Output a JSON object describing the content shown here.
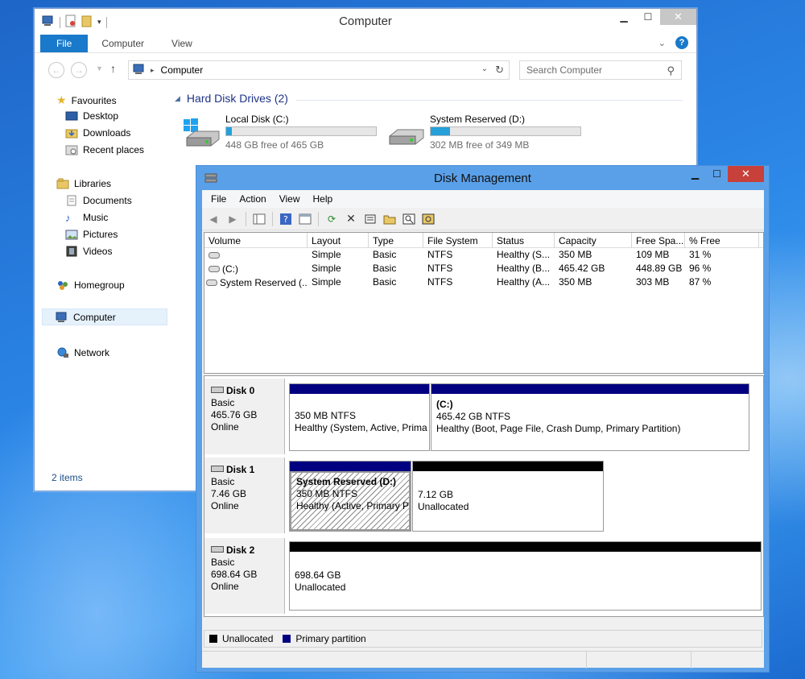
{
  "explorer": {
    "title": "Computer",
    "ribbon_tabs": [
      "File",
      "Computer",
      "View"
    ],
    "address": "Computer",
    "search_placeholder": "Search Computer",
    "nav": {
      "favourites": "Favourites",
      "desktop": "Desktop",
      "downloads": "Downloads",
      "recent": "Recent places",
      "libraries": "Libraries",
      "documents": "Documents",
      "music": "Music",
      "pictures": "Pictures",
      "videos": "Videos",
      "homegroup": "Homegroup",
      "computer": "Computer",
      "network": "Network"
    },
    "group_header": "Hard Disk Drives (2)",
    "drives": [
      {
        "name": "Local Disk (C:)",
        "free_text": "448 GB free of 465 GB",
        "used_fraction": 0.04
      },
      {
        "name": "System Reserved (D:)",
        "free_text": "302 MB free of 349 MB",
        "used_fraction": 0.13
      }
    ],
    "status": "2 items"
  },
  "dm": {
    "title": "Disk Management",
    "menu": [
      "File",
      "Action",
      "View",
      "Help"
    ],
    "columns": [
      "Volume",
      "Layout",
      "Type",
      "File System",
      "Status",
      "Capacity",
      "Free Spa...",
      "% Free"
    ],
    "rows": [
      [
        "",
        "Simple",
        "Basic",
        "NTFS",
        "Healthy (S...",
        "350 MB",
        "109 MB",
        "31 %"
      ],
      [
        "(C:)",
        "Simple",
        "Basic",
        "NTFS",
        "Healthy (B...",
        "465.42 GB",
        "448.89 GB",
        "96 %"
      ],
      [
        "System Reserved (...",
        "Simple",
        "Basic",
        "NTFS",
        "Healthy (A...",
        "350 MB",
        "303 MB",
        "87 %"
      ]
    ],
    "disks": [
      {
        "name": "Disk 0",
        "type": "Basic",
        "size": "465.76 GB",
        "state": "Online",
        "partitions": [
          {
            "name": "",
            "size": "350 MB NTFS",
            "status": "Healthy (System, Active, Prima"
          },
          {
            "name": "(C:)",
            "size": "465.42 GB NTFS",
            "status": "Healthy (Boot, Page File, Crash Dump, Primary Partition)"
          }
        ]
      },
      {
        "name": "Disk 1",
        "type": "Basic",
        "size": "7.46 GB",
        "state": "Online",
        "partitions": [
          {
            "name": "System Reserved  (D:)",
            "size": "350 MB NTFS",
            "status": "Healthy (Active, Primary P"
          },
          {
            "name": "",
            "size": "7.12 GB",
            "status": "Unallocated"
          }
        ]
      },
      {
        "name": "Disk 2",
        "type": "Basic",
        "size": "698.64 GB",
        "state": "Online",
        "partitions": [
          {
            "name": "",
            "size": "698.64 GB",
            "status": "Unallocated"
          }
        ]
      }
    ],
    "legend": {
      "unallocated": "Unallocated",
      "primary": "Primary partition"
    }
  },
  "colors": {
    "primary_partition": "#000080",
    "unallocated": "#000000",
    "drive_bar": "#26a0da",
    "file_tab": "#1979ca"
  }
}
